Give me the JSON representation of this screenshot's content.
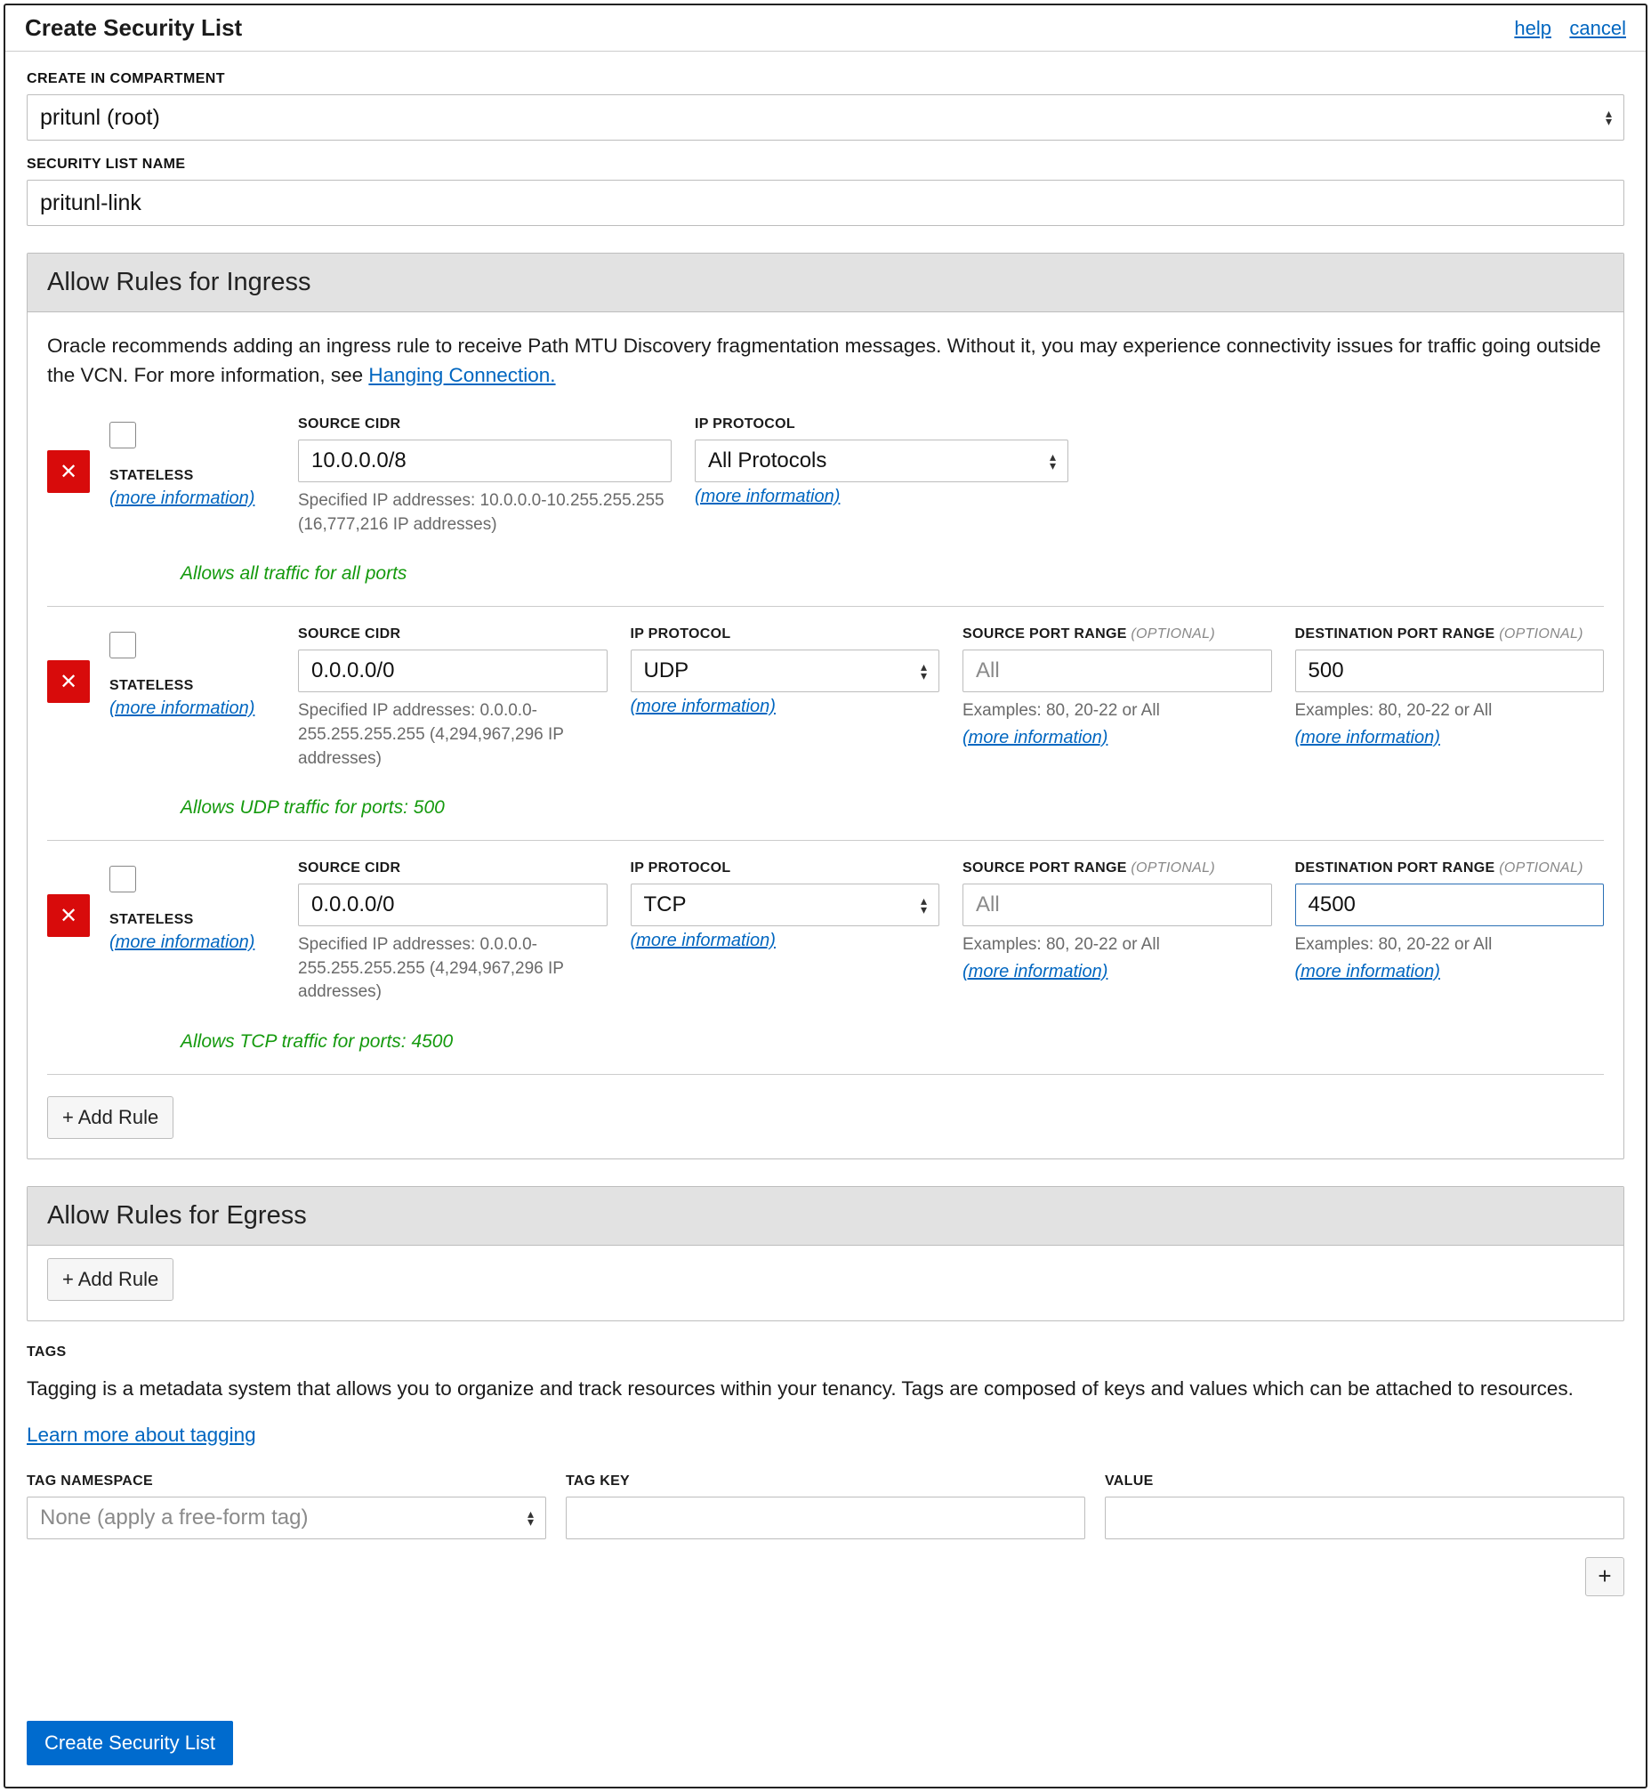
{
  "header": {
    "title": "Create Security List",
    "help": "help",
    "cancel": "cancel"
  },
  "compartment": {
    "label": "CREATE IN COMPARTMENT",
    "value": "pritunl (root)"
  },
  "name": {
    "label": "SECURITY LIST NAME",
    "value": "pritunl-link"
  },
  "ingress": {
    "title": "Allow Rules for Ingress",
    "info_prefix": "Oracle recommends adding an ingress rule to receive Path MTU Discovery fragmentation messages. Without it, you may experience connectivity issues for traffic going outside the VCN. For more information, see ",
    "info_link": "Hanging Connection.",
    "stateless_label": "STATELESS",
    "more_info": "(more information)",
    "add_rule": "+ Add Rule",
    "source_cidr_label": "SOURCE CIDR",
    "ip_proto_label": "IP PROTOCOL",
    "src_port_label": "SOURCE PORT RANGE",
    "dst_port_label": "DESTINATION PORT RANGE",
    "optional": "(OPTIONAL)",
    "examples": "Examples: 80, 20-22 or All",
    "all_placeholder": "All",
    "rules": [
      {
        "cidr": "10.0.0.0/8",
        "cidr_hint": "Specified IP addresses: 10.0.0.0-10.255.255.255 (16,777,216 IP addresses)",
        "protocol": "All Protocols",
        "allow_msg": "Allows all traffic for all ports"
      },
      {
        "cidr": "0.0.0.0/0",
        "cidr_hint": "Specified IP addresses: 0.0.0.0-255.255.255.255 (4,294,967,296 IP addresses)",
        "protocol": "UDP",
        "src_port": "",
        "dst_port": "500",
        "allow_msg": "Allows UDP traffic for ports: 500"
      },
      {
        "cidr": "0.0.0.0/0",
        "cidr_hint": "Specified IP addresses: 0.0.0.0-255.255.255.255 (4,294,967,296 IP addresses)",
        "protocol": "TCP",
        "src_port": "",
        "dst_port": "4500",
        "allow_msg": "Allows TCP traffic for ports: 4500"
      }
    ]
  },
  "egress": {
    "title": "Allow Rules for Egress",
    "add_rule": "+ Add Rule"
  },
  "tags": {
    "label": "TAGS",
    "text": "Tagging is a metadata system that allows you to organize and track resources within your tenancy. Tags are composed of keys and values which can be attached to resources.",
    "link": "Learn more about tagging",
    "namespace_label": "TAG NAMESPACE",
    "namespace_value": "None (apply a free-form tag)",
    "key_label": "TAG KEY",
    "value_label": "VALUE"
  },
  "footer": {
    "create": "Create Security List"
  }
}
